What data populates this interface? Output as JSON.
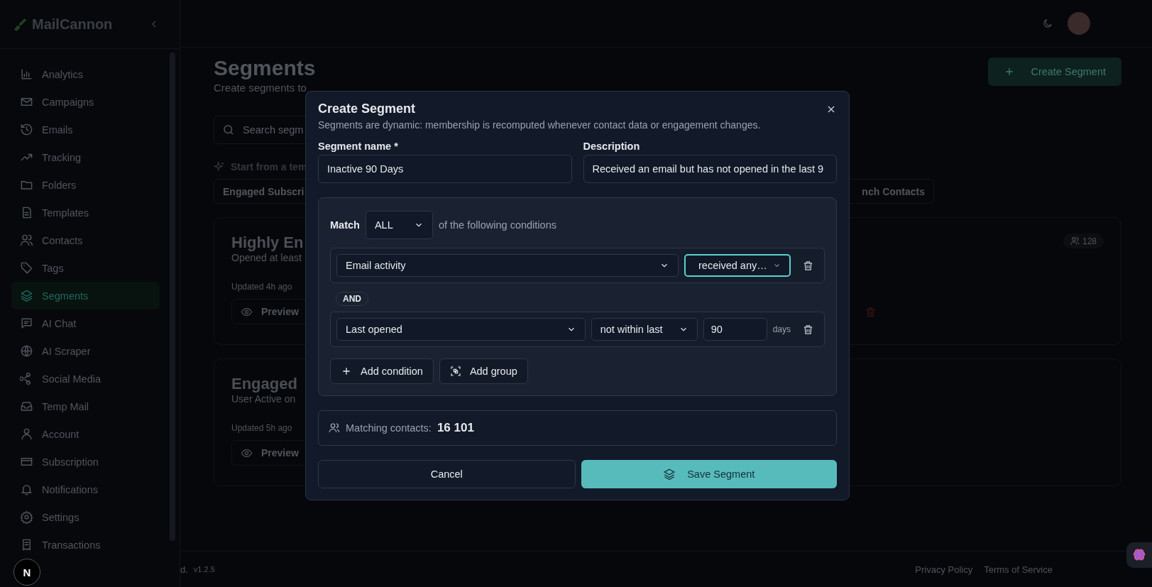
{
  "sidebar": {
    "logo": "MailCannon",
    "items": [
      {
        "label": "Analytics",
        "selected": false
      },
      {
        "label": "Campaigns",
        "selected": false
      },
      {
        "label": "Emails",
        "selected": false
      },
      {
        "label": "Tracking",
        "selected": false
      },
      {
        "label": "Folders",
        "selected": false
      },
      {
        "label": "Templates",
        "selected": false
      },
      {
        "label": "Contacts",
        "selected": false
      },
      {
        "label": "Tags",
        "selected": false
      },
      {
        "label": "Segments",
        "selected": true
      },
      {
        "label": "AI Chat",
        "selected": false
      },
      {
        "label": "AI Scraper",
        "selected": false
      },
      {
        "label": "Social Media",
        "selected": false
      },
      {
        "label": "Temp Mail",
        "selected": false
      },
      {
        "label": "Account",
        "selected": false
      },
      {
        "label": "Subscription",
        "selected": false
      },
      {
        "label": "Notifications",
        "selected": false
      },
      {
        "label": "Settings",
        "selected": false
      },
      {
        "label": "Transactions",
        "selected": false
      }
    ],
    "dev_badge": "N"
  },
  "page": {
    "title": "Segments",
    "subtitle": "Create segments to",
    "create_button": "Create Segment",
    "search_placeholder": "Search segm",
    "template_label": "Start from a tem",
    "template_chips": [
      "Engaged Subscri",
      "nch Contacts"
    ],
    "segments": [
      {
        "title": "Highly En",
        "description": "Opened at least",
        "updated": "Updated 4h ago",
        "preview": "Preview",
        "count": "128"
      },
      {
        "title": "Engaged",
        "description": "User Active on",
        "updated": "Updated 5h ago",
        "preview": "Preview"
      }
    ]
  },
  "footer": {
    "left": "d.",
    "version": "v1.2.5",
    "links": [
      "Privacy Policy",
      "Terms of Service"
    ]
  },
  "modal": {
    "title": "Create Segment",
    "subtitle": "Segments are dynamic: membership is recomputed whenever contact data or engagement changes.",
    "name_label": "Segment name *",
    "name_value": "Inactive 90 Days",
    "description_label": "Description",
    "description_value": "Received an email but has not opened in the last 9",
    "match_label": "Match",
    "match_value": "ALL",
    "match_suffix": "of the following conditions",
    "joiner": "AND",
    "conditions": [
      {
        "kind": "activity",
        "field": "Email activity",
        "operator": "received any…",
        "focused": true
      },
      {
        "kind": "date",
        "field": "Last opened",
        "operator": "not within last",
        "focused": false,
        "value": "90",
        "unit": "days"
      }
    ],
    "add_condition": "Add condition",
    "add_group": "Add group",
    "matching_label": "Matching contacts:",
    "matching_count": "16 101",
    "cancel": "Cancel",
    "save": "Save Segment"
  }
}
